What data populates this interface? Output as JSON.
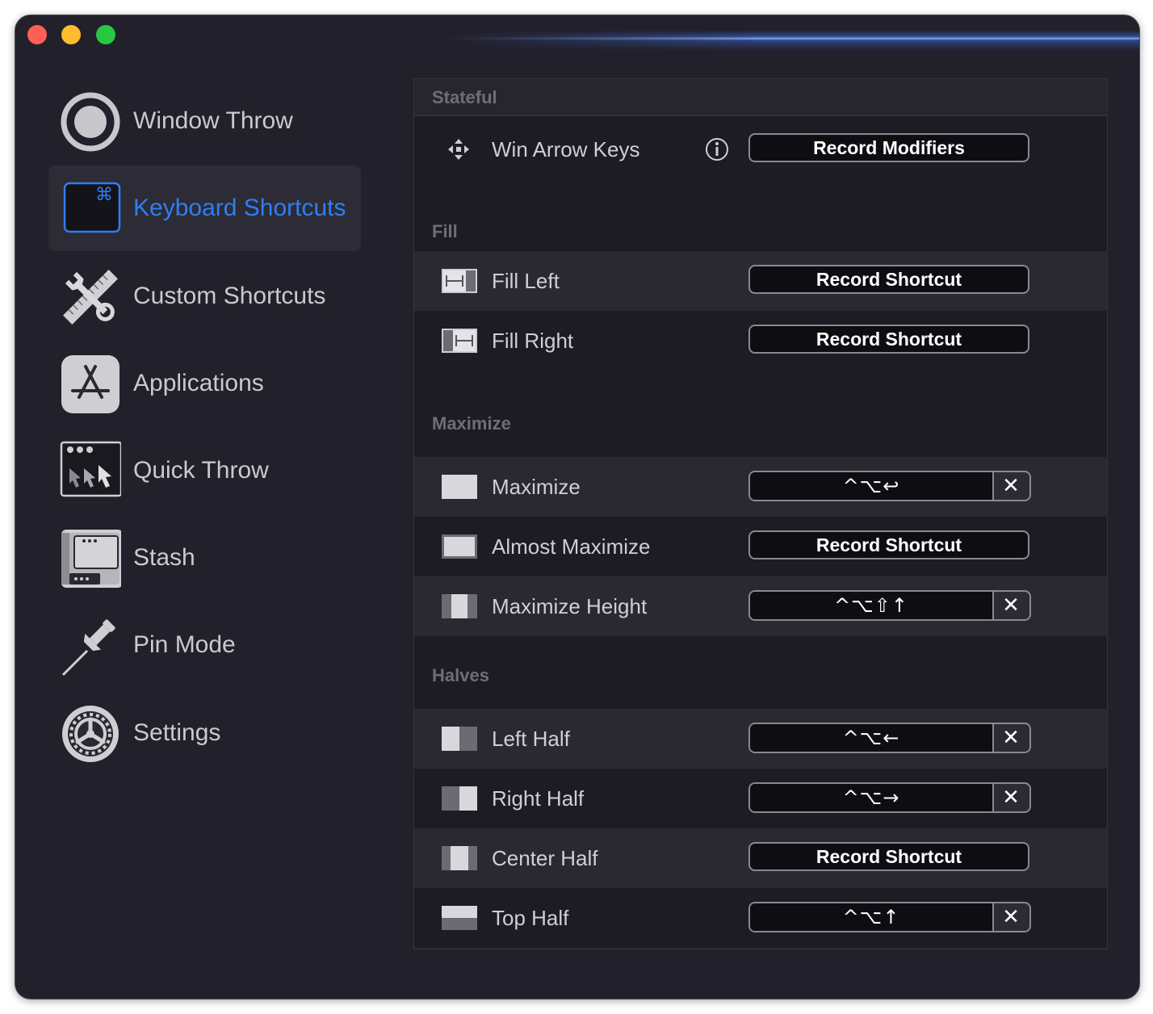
{
  "window": {
    "controls": [
      "close",
      "minimize",
      "zoom"
    ]
  },
  "sidebar": {
    "selected": "Keyboard Shortcuts",
    "accent_color": "#2f7ff0",
    "items": [
      {
        "label": "Window Throw",
        "icon": "window-throw-icon"
      },
      {
        "label": "Keyboard Shortcuts",
        "icon": "keyboard-command-icon"
      },
      {
        "label": "Custom Shortcuts",
        "icon": "tools-icon"
      },
      {
        "label": "Applications",
        "icon": "app-store-icon"
      },
      {
        "label": "Quick Throw",
        "icon": "quick-throw-icon"
      },
      {
        "label": "Stash",
        "icon": "stash-icon"
      },
      {
        "label": "Pin Mode",
        "icon": "pushpin-icon"
      },
      {
        "label": "Settings",
        "icon": "gear-icon"
      }
    ]
  },
  "sections": {
    "stateful": {
      "header": "Stateful",
      "rows": [
        {
          "label": "Win Arrow Keys",
          "button": "Record Modifiers",
          "icon": "move-arrows-icon",
          "info_icon": "info-icon"
        }
      ]
    },
    "fill": {
      "header": "Fill",
      "rows": [
        {
          "label": "Fill Left",
          "button": "Record Shortcut",
          "icon": "fill-left-icon"
        },
        {
          "label": "Fill Right",
          "button": "Record Shortcut",
          "icon": "fill-right-icon"
        }
      ]
    },
    "maximize": {
      "header": "Maximize",
      "rows": [
        {
          "label": "Maximize",
          "shortcut": "^⌥↩",
          "clear": "✕",
          "icon": "maximize-icon"
        },
        {
          "label": "Almost Maximize",
          "button": "Record Shortcut",
          "icon": "almost-maximize-icon"
        },
        {
          "label": "Maximize Height",
          "shortcut": "^⌥⇧↑",
          "clear": "✕",
          "icon": "maximize-height-icon"
        }
      ]
    },
    "halves": {
      "header": "Halves",
      "rows": [
        {
          "label": "Left Half",
          "shortcut": "^⌥←",
          "clear": "✕",
          "icon": "left-half-icon"
        },
        {
          "label": "Right Half",
          "shortcut": "^⌥→",
          "clear": "✕",
          "icon": "right-half-icon"
        },
        {
          "label": "Center Half",
          "button": "Record Shortcut",
          "icon": "center-half-icon"
        },
        {
          "label": "Top Half",
          "shortcut": "^⌥↑",
          "clear": "✕",
          "icon": "top-half-icon"
        }
      ]
    }
  }
}
